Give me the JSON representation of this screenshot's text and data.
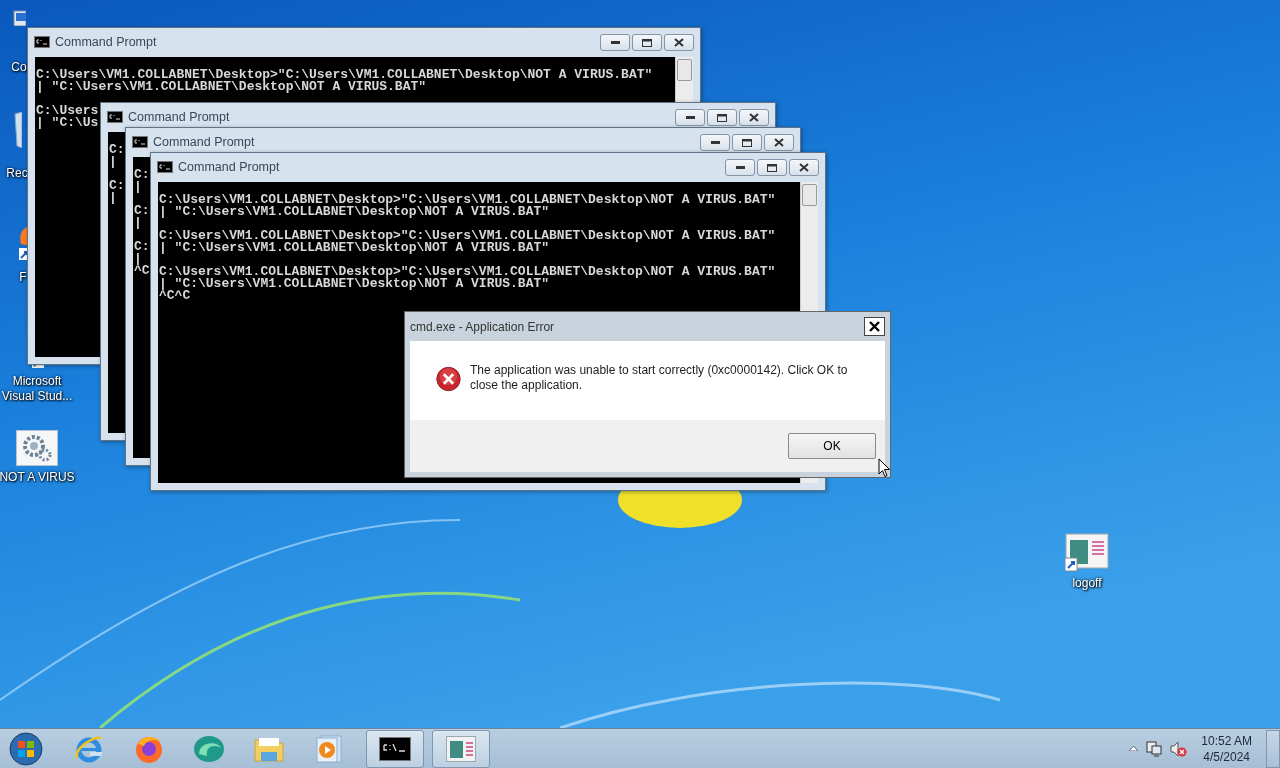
{
  "desktop_icons": [
    {
      "label": "Co",
      "kind": "computer"
    },
    {
      "label": "Rec",
      "kind": "recycle"
    },
    {
      "label": "F",
      "kind": "firefox"
    },
    {
      "label": "Microsoft Visual Stud...",
      "kind": "studio"
    },
    {
      "label": "NOT A VIRUS",
      "kind": "settings"
    },
    {
      "label": "logoff",
      "kind": "app"
    }
  ],
  "windows": [
    {
      "title": "Command Prompt",
      "blocks": [
        [
          "C:\\Users\\VM1.COLLABNET\\Desktop>\"C:\\Users\\VM1.COLLABNET\\Desktop\\NOT A VIRUS.BAT\"",
          "| \"C:\\Users\\VM1.COLLABNET\\Desktop\\NOT A VIRUS.BAT\""
        ],
        [
          "C:\\Users",
          "| \"C:\\Us"
        ]
      ]
    },
    {
      "title": "Command Prompt",
      "blocks": [
        [
          "C:",
          "|"
        ],
        [
          "C:",
          "|"
        ]
      ]
    },
    {
      "title": "Command Prompt",
      "blocks": [
        [
          "C:",
          "|"
        ],
        [
          "C:",
          "|"
        ],
        [
          "C:",
          "|",
          "^C"
        ]
      ]
    },
    {
      "title": "Command Prompt",
      "blocks": [
        [
          "C:\\Users\\VM1.COLLABNET\\Desktop>\"C:\\Users\\VM1.COLLABNET\\Desktop\\NOT A VIRUS.BAT\"",
          "| \"C:\\Users\\VM1.COLLABNET\\Desktop\\NOT A VIRUS.BAT\""
        ],
        [
          "C:\\Users\\VM1.COLLABNET\\Desktop>\"C:\\Users\\VM1.COLLABNET\\Desktop\\NOT A VIRUS.BAT\"",
          "| \"C:\\Users\\VM1.COLLABNET\\Desktop\\NOT A VIRUS.BAT\""
        ],
        [
          "C:\\Users\\VM1.COLLABNET\\Desktop>\"C:\\Users\\VM1.COLLABNET\\Desktop\\NOT A VIRUS.BAT\"",
          "| \"C:\\Users\\VM1.COLLABNET\\Desktop\\NOT A VIRUS.BAT\"",
          "^C^C"
        ]
      ]
    }
  ],
  "dialog": {
    "title": "cmd.exe - Application Error",
    "message": "The application was unable to start correctly (0xc0000142). Click OK to close the application.",
    "button": "OK"
  },
  "taskbar": {
    "items": [
      {
        "kind": "ie",
        "running": false
      },
      {
        "kind": "firefox",
        "running": false
      },
      {
        "kind": "swirl",
        "running": false
      },
      {
        "kind": "folder",
        "running": false
      },
      {
        "kind": "media",
        "running": false
      },
      {
        "kind": "console",
        "running": true
      },
      {
        "kind": "app",
        "running": true
      }
    ],
    "time": "10:52 AM",
    "date": "4/5/2024"
  }
}
